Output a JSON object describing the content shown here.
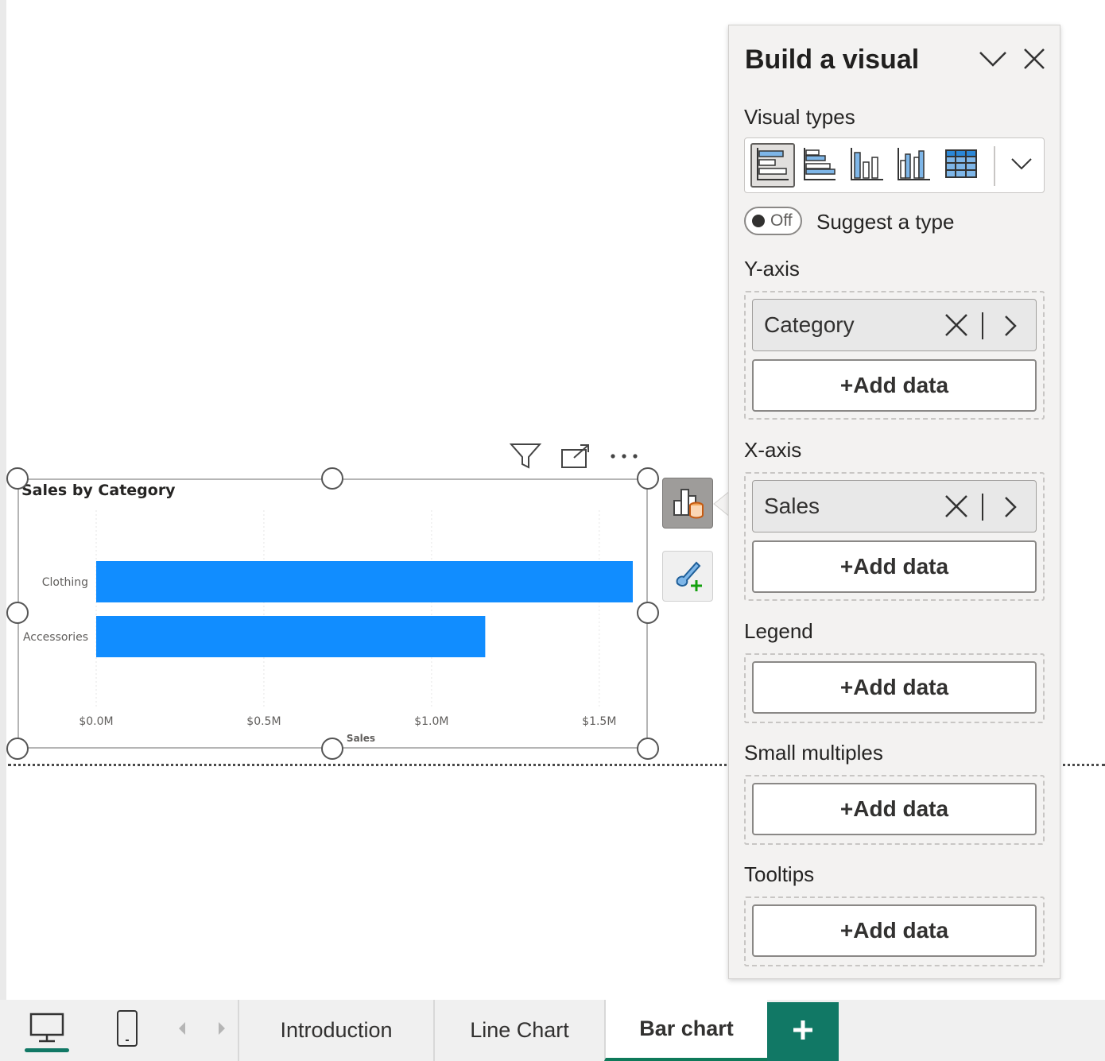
{
  "report": {
    "visual": {
      "title": "Sales by Category",
      "header_icons": [
        "filter-icon",
        "focus-mode-icon",
        "more-options-icon"
      ]
    },
    "side_buttons": [
      "build-visual-icon",
      "format-visual-icon"
    ]
  },
  "pane": {
    "title": "Build a visual",
    "visual_types_label": "Visual types",
    "visual_types": [
      "stacked-bar-chart",
      "clustered-bar-chart",
      "stacked-column-chart",
      "clustered-column-chart",
      "table"
    ],
    "suggest_toggle": {
      "state": "Off",
      "label": "Suggest a type"
    },
    "wells": [
      {
        "label": "Y-axis",
        "fields": [
          "Category"
        ],
        "add_label": "+Add data"
      },
      {
        "label": "X-axis",
        "fields": [
          "Sales"
        ],
        "add_label": "+Add data"
      },
      {
        "label": "Legend",
        "fields": [],
        "add_label": "+Add data"
      },
      {
        "label": "Small multiples",
        "fields": [],
        "add_label": "+Add data"
      },
      {
        "label": "Tooltips",
        "fields": [],
        "add_label": "+Add data"
      }
    ]
  },
  "tabs": {
    "pages": [
      "Introduction",
      "Line Chart",
      "Bar chart"
    ],
    "active": "Bar chart",
    "view_icons": [
      "desktop-view-icon",
      "mobile-view-icon"
    ]
  },
  "colors": {
    "bar": "#118dff",
    "accent": "#117865"
  },
  "chart_data": {
    "type": "bar",
    "orientation": "horizontal",
    "title": "Sales by Category",
    "categories": [
      "Clothing",
      "Accessories"
    ],
    "values": [
      1.6,
      1.16
    ],
    "unit": "$M",
    "xlabel": "Sales",
    "xticks": [
      "$0.0M",
      "$0.5M",
      "$1.0M",
      "$1.5M"
    ],
    "xlim": [
      0,
      1.6
    ],
    "grid": true
  }
}
